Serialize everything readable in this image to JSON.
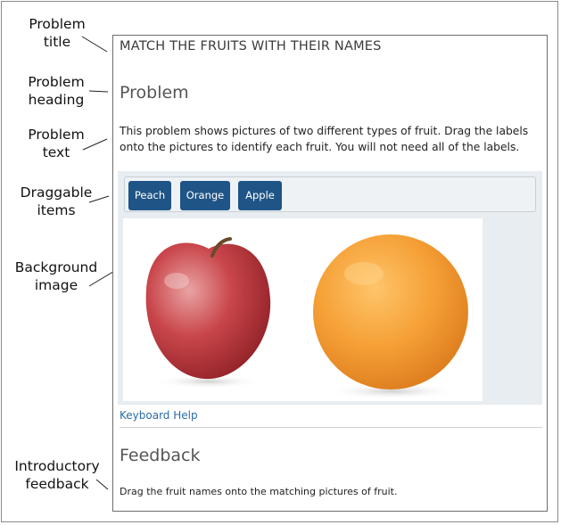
{
  "annotations": [
    {
      "line1": "Problem",
      "line2": "title"
    },
    {
      "line1": "Problem",
      "line2": "heading"
    },
    {
      "line1": "Problem",
      "line2": "text"
    },
    {
      "line1": "Draggable",
      "line2": "items"
    },
    {
      "line1": "Background",
      "line2": "image"
    },
    {
      "line1": "Introductory",
      "line2": "feedback"
    }
  ],
  "problem": {
    "title": "MATCH THE FRUITS WITH THEIR NAMES",
    "heading": "Problem",
    "text": "This problem shows pictures of two different types of fruit. Drag the labels onto the pictures to identify each fruit. You will not need all of the labels.",
    "draggable_items": [
      "Peach",
      "Orange",
      "Apple"
    ],
    "keyboard_help": "Keyboard Help",
    "feedback_heading": "Feedback",
    "feedback_text": "Drag the fruit names onto the matching pictures of fruit."
  },
  "colors": {
    "chip": "#1f5486",
    "link": "#2a6ca8",
    "dnd_background": "#e8edf1"
  }
}
